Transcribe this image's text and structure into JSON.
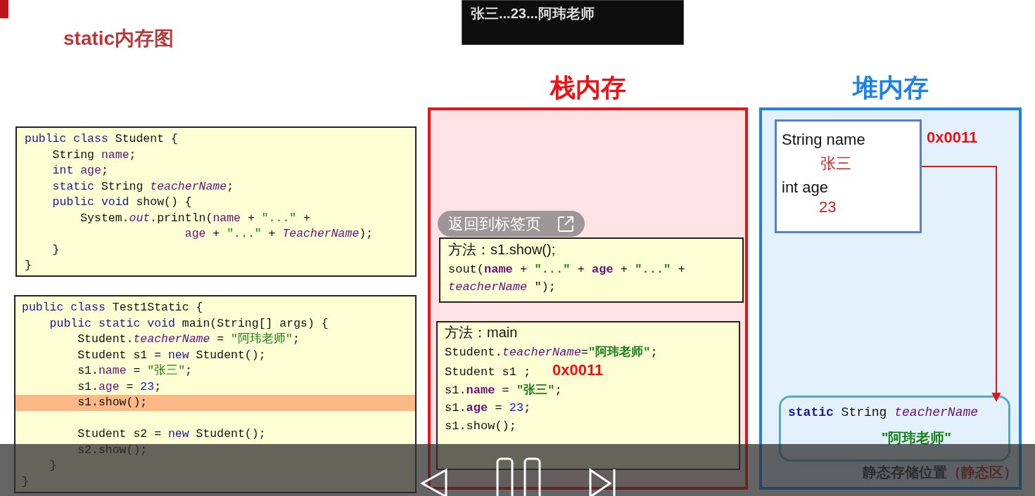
{
  "slide_title": "static内存图",
  "caption": "张三...23...阿玮老师",
  "class_code": {
    "lines": [
      {
        "tokens": [
          {
            "text": "public class",
            "kind": "kw"
          },
          {
            "text": " Student {",
            "kind": "plain"
          }
        ]
      },
      {
        "tokens": [
          {
            "text": "    String ",
            "kind": "plain"
          },
          {
            "text": "name",
            "kind": "field"
          },
          {
            "text": ";",
            "kind": "plain"
          }
        ]
      },
      {
        "tokens": [
          {
            "text": "    int",
            "kind": "kw"
          },
          {
            "text": " age",
            "kind": "field"
          },
          {
            "text": ";",
            "kind": "plain"
          }
        ]
      },
      {
        "tokens": [
          {
            "text": "    static",
            "kind": "kw"
          },
          {
            "text": " String ",
            "kind": "plain"
          },
          {
            "text": "teacherName",
            "kind": "static"
          },
          {
            "text": ";",
            "kind": "plain"
          }
        ]
      },
      {
        "tokens": [
          {
            "text": "    public void",
            "kind": "kw"
          },
          {
            "text": " show() {",
            "kind": "plain"
          }
        ]
      },
      {
        "tokens": [
          {
            "text": "        System.",
            "kind": "plain"
          },
          {
            "text": "out",
            "kind": "static"
          },
          {
            "text": ".println(",
            "kind": "plain"
          },
          {
            "text": "name",
            "kind": "field"
          },
          {
            "text": " + ",
            "kind": "plain"
          },
          {
            "text": "\"...\"",
            "kind": "str"
          },
          {
            "text": " +",
            "kind": "plain"
          }
        ]
      },
      {
        "tokens": [
          {
            "text": "                       age",
            "kind": "field"
          },
          {
            "text": " + ",
            "kind": "plain"
          },
          {
            "text": "\"...\"",
            "kind": "str"
          },
          {
            "text": " + ",
            "kind": "plain"
          },
          {
            "text": "TeacherName",
            "kind": "static"
          },
          {
            "text": ");",
            "kind": "plain"
          }
        ]
      },
      {
        "tokens": [
          {
            "text": "    }",
            "kind": "plain"
          }
        ]
      },
      {
        "tokens": [
          {
            "text": "}",
            "kind": "plain"
          }
        ]
      }
    ]
  },
  "main_code": {
    "lines": [
      {
        "highlighted": false,
        "tokens": [
          {
            "text": "public class",
            "kind": "kw"
          },
          {
            "text": " Test1Static {",
            "kind": "plain"
          }
        ]
      },
      {
        "highlighted": false,
        "tokens": [
          {
            "text": "    public static void",
            "kind": "kw"
          },
          {
            "text": " main(String[] args) {",
            "kind": "plain"
          }
        ]
      },
      {
        "highlighted": false,
        "tokens": [
          {
            "text": "        Student.",
            "kind": "plain"
          },
          {
            "text": "teacherName",
            "kind": "static"
          },
          {
            "text": " = ",
            "kind": "plain"
          },
          {
            "text": "\"阿玮老师\"",
            "kind": "str"
          },
          {
            "text": ";",
            "kind": "plain"
          }
        ]
      },
      {
        "highlighted": false,
        "tokens": [
          {
            "text": "        Student s1 = ",
            "kind": "plain"
          },
          {
            "text": "new",
            "kind": "kw"
          },
          {
            "text": " Student();",
            "kind": "plain"
          }
        ]
      },
      {
        "highlighted": false,
        "tokens": [
          {
            "text": "        s1.",
            "kind": "plain"
          },
          {
            "text": "name",
            "kind": "field"
          },
          {
            "text": " = ",
            "kind": "plain"
          },
          {
            "text": "\"张三\"",
            "kind": "str"
          },
          {
            "text": ";",
            "kind": "plain"
          }
        ]
      },
      {
        "highlighted": false,
        "tokens": [
          {
            "text": "        s1.",
            "kind": "plain"
          },
          {
            "text": "age",
            "kind": "field"
          },
          {
            "text": " = ",
            "kind": "plain"
          },
          {
            "text": "23",
            "kind": "num"
          },
          {
            "text": ";",
            "kind": "plain"
          }
        ]
      },
      {
        "highlighted": true,
        "tokens": [
          {
            "text": "        s1.show();",
            "kind": "plain"
          }
        ]
      },
      {
        "highlighted": false
      },
      {
        "highlighted": false,
        "tokens": [
          {
            "text": "        Student s2 = ",
            "kind": "plain"
          },
          {
            "text": "new",
            "kind": "kw"
          },
          {
            "text": " Student();",
            "kind": "plain"
          }
        ]
      },
      {
        "highlighted": false,
        "tokens": [
          {
            "text": "        s2.show();",
            "kind": "plain"
          }
        ]
      },
      {
        "highlighted": false,
        "tokens": [
          {
            "text": "    }",
            "kind": "plain"
          }
        ]
      },
      {
        "highlighted": false,
        "tokens": [
          {
            "text": "}",
            "kind": "plain"
          }
        ]
      }
    ]
  },
  "stack": {
    "title": "栈内存",
    "frames": [
      {
        "lines": [
          {
            "tokens": [
              {
                "text": "方法：s1.show();",
                "kind": "label"
              }
            ]
          },
          {
            "tokens": [
              {
                "text": "sout(",
                "kind": "plain"
              },
              {
                "text": "name",
                "kind": "field_bold"
              },
              {
                "text": " + ",
                "kind": "plain"
              },
              {
                "text": "\"...\"",
                "kind": "str_bold"
              },
              {
                "text": " + ",
                "kind": "plain"
              },
              {
                "text": "age",
                "kind": "field_bold"
              },
              {
                "text": " + ",
                "kind": "plain"
              },
              {
                "text": "\"...\"",
                "kind": "str_bold"
              },
              {
                "text": " +",
                "kind": "plain"
              }
            ]
          },
          {
            "tokens": [
              {
                "text": "teacherName",
                "kind": "static"
              },
              {
                "text": " \");",
                "kind": "plain"
              }
            ]
          }
        ]
      },
      {
        "lines": [
          {
            "tokens": [
              {
                "text": "方法：main",
                "kind": "label"
              }
            ]
          },
          {
            "tokens": [
              {
                "text": "Student.",
                "kind": "plain"
              },
              {
                "text": "teacherName",
                "kind": "static"
              },
              {
                "text": "=",
                "kind": "plain"
              },
              {
                "text": "\"阿玮老师\"",
                "kind": "str_bold"
              },
              {
                "text": ";",
                "kind": "plain"
              }
            ]
          },
          {
            "tokens": [
              {
                "text": "Student s1 ;   ",
                "kind": "plain"
              },
              {
                "text": "0x0011",
                "kind": "address"
              }
            ]
          },
          {
            "tokens": [
              {
                "text": "s1.",
                "kind": "plain"
              },
              {
                "text": "name",
                "kind": "field_bold"
              },
              {
                "text": " = ",
                "kind": "plain"
              },
              {
                "text": "\"张三\"",
                "kind": "str_bold"
              },
              {
                "text": ";",
                "kind": "plain"
              }
            ]
          },
          {
            "tokens": [
              {
                "text": "s1.",
                "kind": "plain"
              },
              {
                "text": "age",
                "kind": "field_bold"
              },
              {
                "text": " = ",
                "kind": "plain"
              },
              {
                "text": "23",
                "kind": "num"
              },
              {
                "text": ";",
                "kind": "plain"
              }
            ]
          },
          {
            "tokens": [
              {
                "text": "s1.show();",
                "kind": "plain"
              }
            ]
          }
        ]
      }
    ]
  },
  "return_tab": {
    "label": "返回到标签页"
  },
  "heap": {
    "title": "堆内存",
    "object": {
      "address": "0x0011",
      "fields": [
        {
          "label": "String name",
          "value": "张三"
        },
        {
          "label": "int age",
          "value": "23"
        }
      ]
    },
    "static_area": {
      "tokens": [
        {
          "text": "static",
          "kind": "kw_bold"
        },
        {
          "text": " String ",
          "kind": "plain"
        },
        {
          "text": "teacherName",
          "kind": "static"
        }
      ],
      "value": "\"阿玮老师\"",
      "caption": "静态存储位置",
      "caption_note": "（静态区）"
    }
  },
  "player": {
    "controls": [
      {
        "kind": "previous"
      },
      {
        "kind": "pause"
      },
      {
        "kind": "next"
      }
    ]
  }
}
